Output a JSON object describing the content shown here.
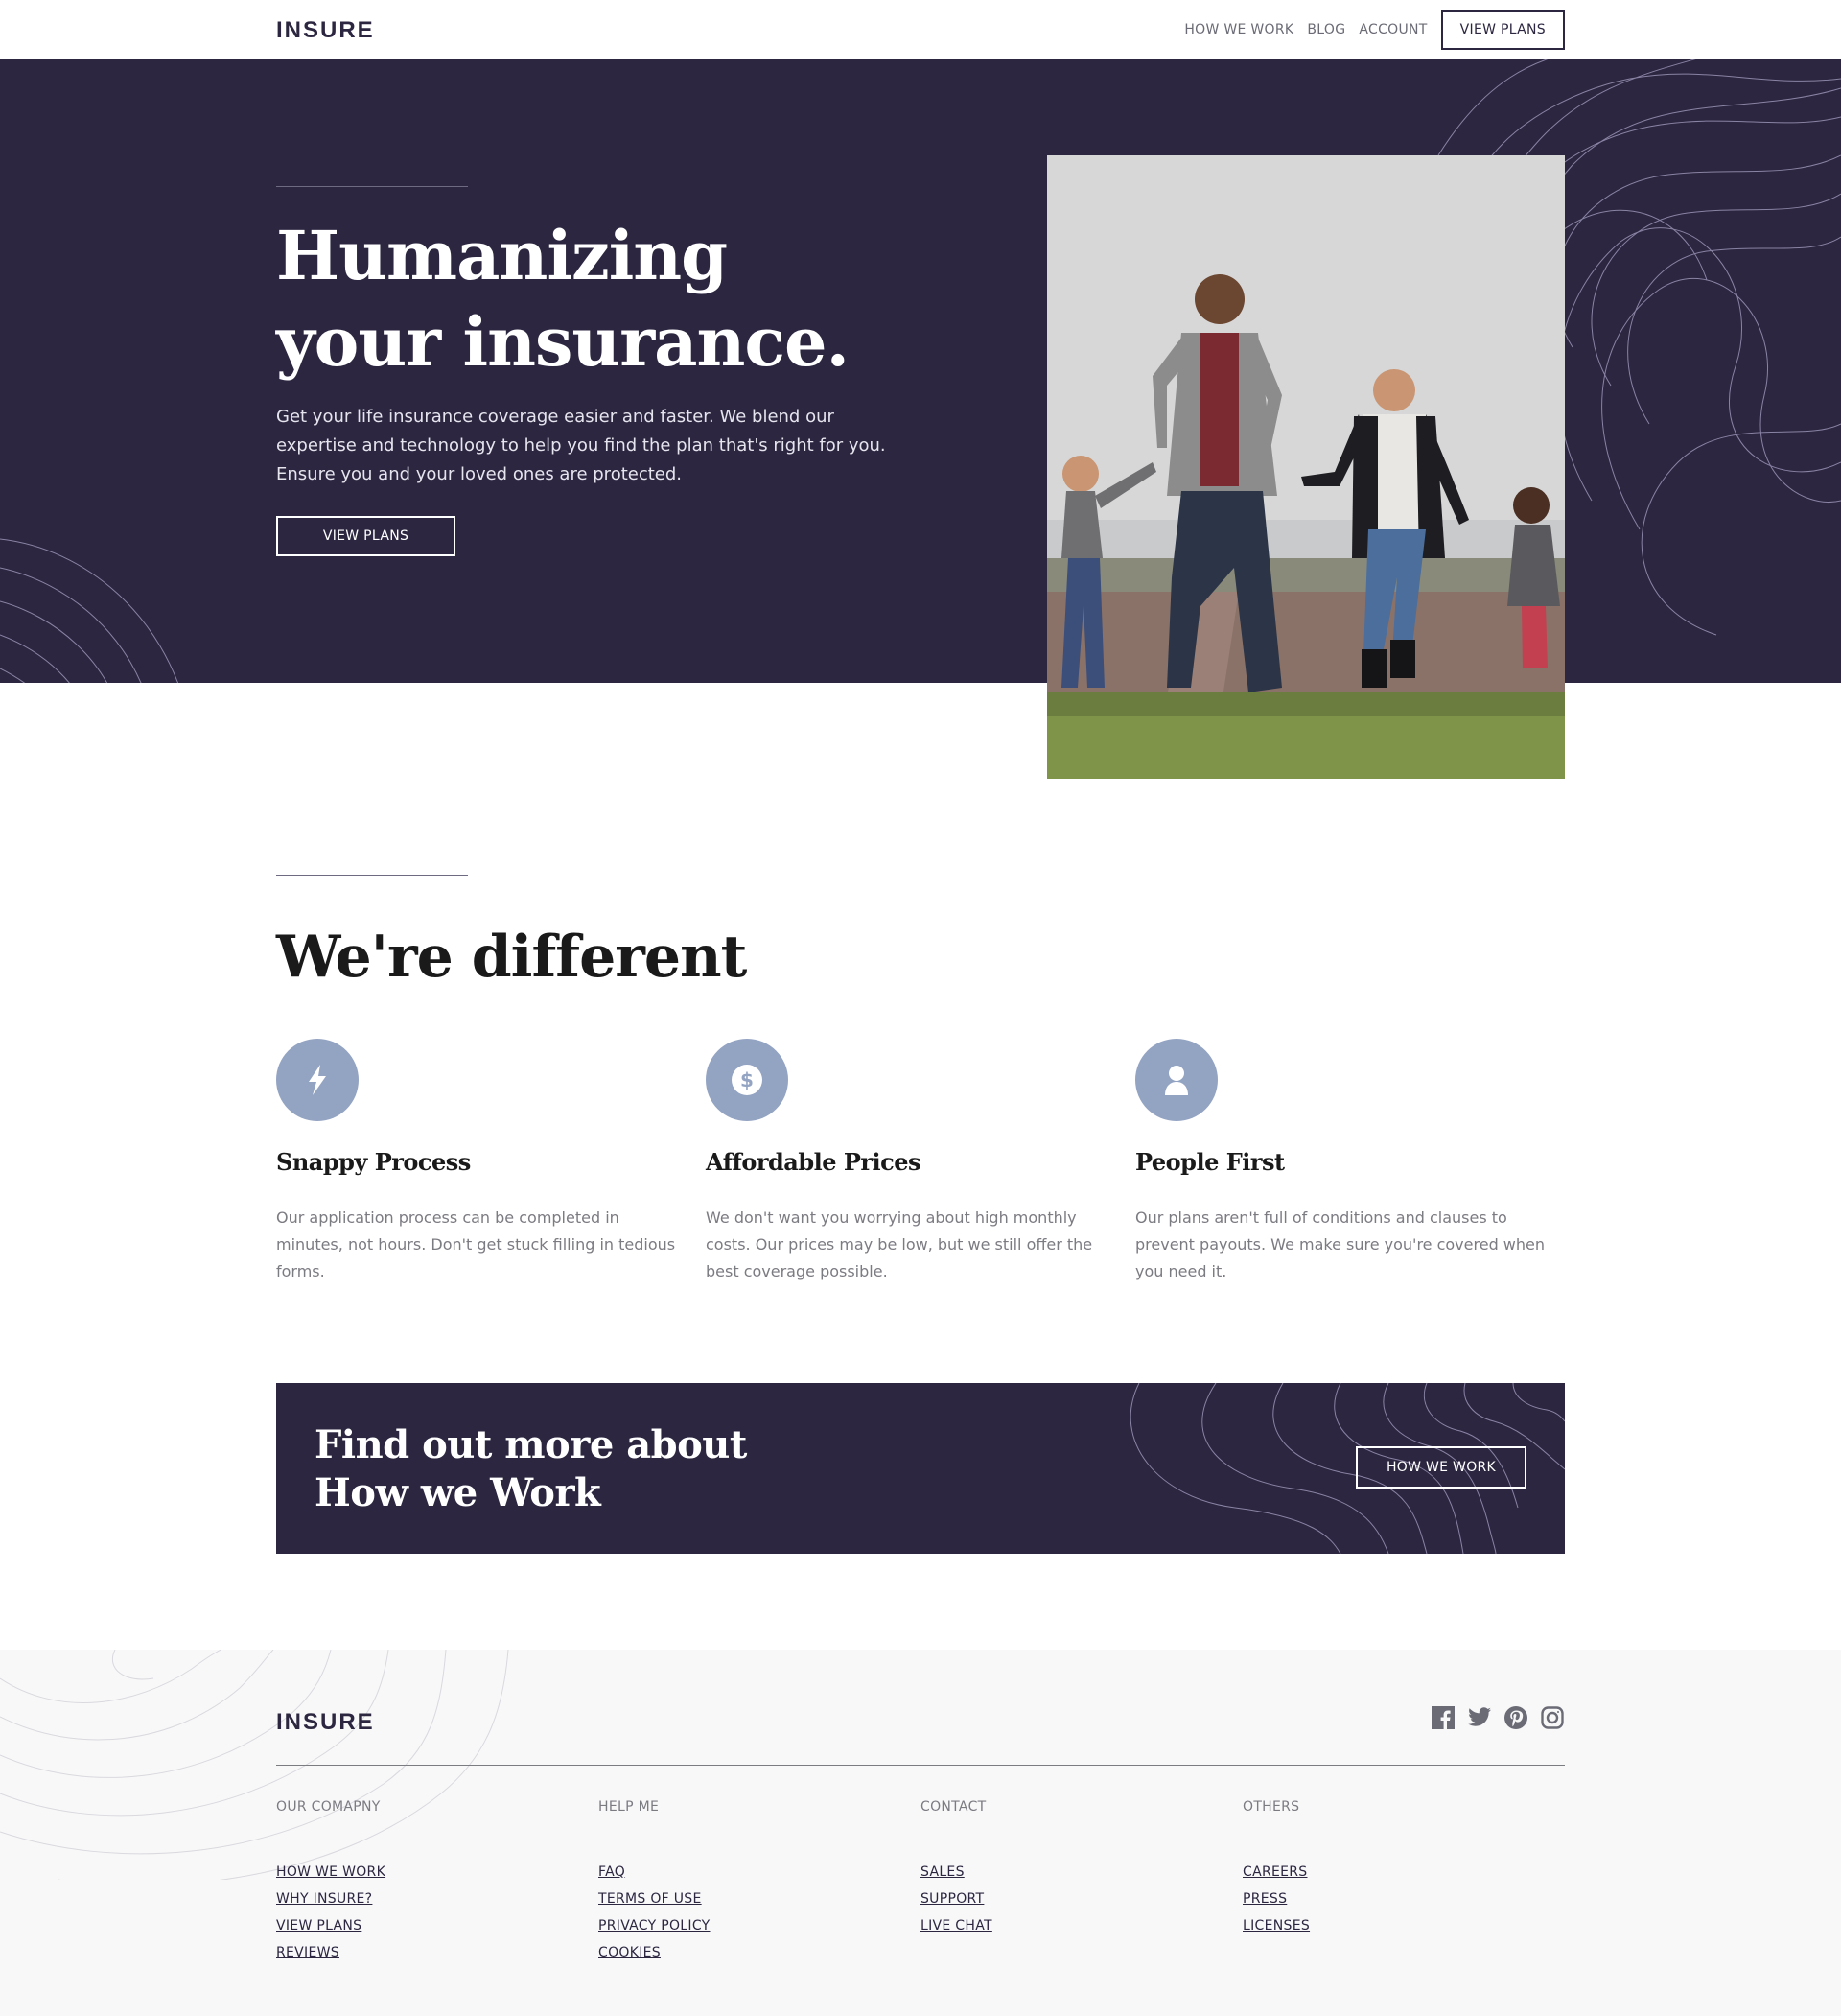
{
  "brand": {
    "logo_text": "INSURE",
    "colors": {
      "dark_violet": "#2c2640",
      "grayish_blue": "#93a3c2",
      "white": "#ffffff",
      "light_gray": "#f8f8f9"
    }
  },
  "nav": {
    "links": [
      "HOW WE WORK",
      "BLOG",
      "ACCOUNT"
    ],
    "cta_label": "VIEW PLANS"
  },
  "hero": {
    "title": "Humanizing your insurance.",
    "text": "Get your life insurance coverage easier and faster. We blend our expertise and technology to help you find the plan that's right for you. Ensure you and your loved ones are protected.",
    "button_label": "VIEW PLANS"
  },
  "different": {
    "title": "We're different",
    "features": [
      {
        "icon": "lightning-bolt-icon",
        "title": "Snappy Process",
        "text": "Our application process can be completed in minutes, not hours. Don't get stuck filling in tedious forms."
      },
      {
        "icon": "dollar-icon",
        "title": "Affordable Prices",
        "text": "We don't want you worrying about high monthly costs. Our prices may be low, but we still offer the best coverage possible."
      },
      {
        "icon": "person-icon",
        "title": "People First",
        "text": "Our plans aren't full of conditions and clauses to prevent payouts. We make sure you're covered when you need it."
      }
    ]
  },
  "cta": {
    "title": "Find out more about How we Work",
    "button_label": "HOW WE WORK"
  },
  "footer": {
    "logo_text": "INSURE",
    "socials": [
      "facebook-icon",
      "twitter-icon",
      "pinterest-icon",
      "instagram-icon"
    ],
    "columns": [
      {
        "heading": "OUR COMAPNY",
        "links": [
          "HOW WE WORK",
          "WHY INSURE?",
          "VIEW PLANS",
          "REVIEWS"
        ]
      },
      {
        "heading": "HELP ME",
        "links": [
          "FAQ",
          "TERMS OF USE",
          "PRIVACY POLICY",
          "COOKIES"
        ]
      },
      {
        "heading": "CONTACT",
        "links": [
          "SALES",
          "SUPPORT",
          "LIVE CHAT"
        ]
      },
      {
        "heading": "OTHERS",
        "links": [
          "CAREERS",
          "PRESS",
          "LICENSES"
        ]
      }
    ]
  }
}
